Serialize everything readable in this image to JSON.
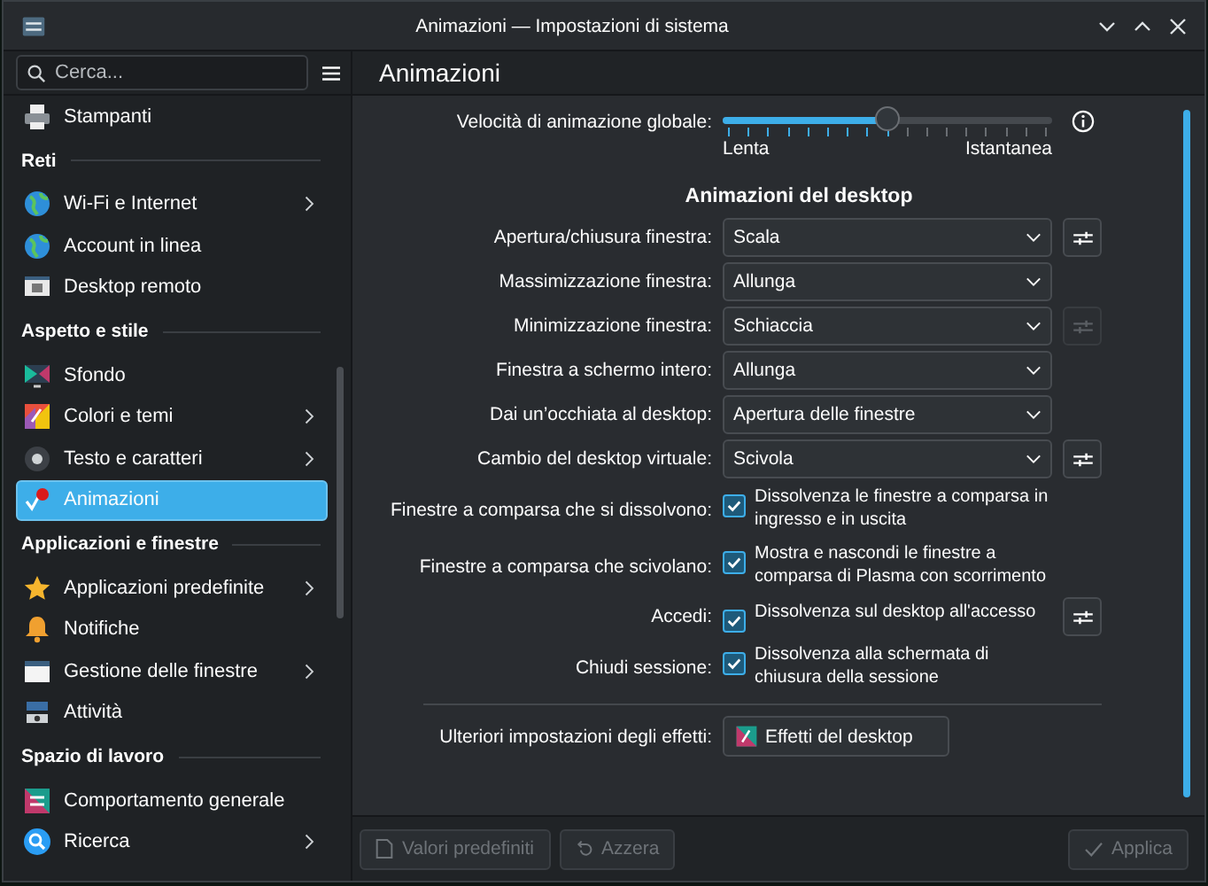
{
  "window": {
    "title": "Animazioni — Impostazioni di sistema"
  },
  "sidebar": {
    "search": {
      "placeholder": "Cerca..."
    },
    "entries": [
      {
        "kind": "item",
        "label": "Stampanti",
        "has_children": false,
        "selected": false
      },
      {
        "kind": "header",
        "label": "Reti"
      },
      {
        "kind": "item",
        "label": "Wi-Fi e Internet",
        "has_children": true,
        "selected": false
      },
      {
        "kind": "item",
        "label": "Account in linea",
        "has_children": false,
        "selected": false
      },
      {
        "kind": "item",
        "label": "Desktop remoto",
        "has_children": false,
        "selected": false
      },
      {
        "kind": "header",
        "label": "Aspetto e stile"
      },
      {
        "kind": "item",
        "label": "Sfondo",
        "has_children": false,
        "selected": false
      },
      {
        "kind": "item",
        "label": "Colori e temi",
        "has_children": true,
        "selected": false
      },
      {
        "kind": "item",
        "label": "Testo e caratteri",
        "has_children": true,
        "selected": false
      },
      {
        "kind": "item",
        "label": "Animazioni",
        "has_children": false,
        "selected": true
      },
      {
        "kind": "header",
        "label": "Applicazioni e finestre"
      },
      {
        "kind": "item",
        "label": "Applicazioni predefinite",
        "has_children": true,
        "selected": false
      },
      {
        "kind": "item",
        "label": "Notifiche",
        "has_children": false,
        "selected": false
      },
      {
        "kind": "item",
        "label": "Gestione delle finestre",
        "has_children": true,
        "selected": false
      },
      {
        "kind": "item",
        "label": "Attività",
        "has_children": false,
        "selected": false
      },
      {
        "kind": "header",
        "label": "Spazio di lavoro"
      },
      {
        "kind": "item",
        "label": "Comportamento generale",
        "has_children": false,
        "selected": false
      },
      {
        "kind": "item",
        "label": "Ricerca",
        "has_children": true,
        "selected": false
      }
    ]
  },
  "page_title": "Animazioni",
  "speed": {
    "label": "Velocità di animazione globale:",
    "level": 0.5,
    "min_label": "Lenta",
    "max_label": "Istantanea"
  },
  "section_title": "Animazioni del desktop",
  "rows": [
    {
      "kind": "dropdown",
      "label": "Apertura/chiusura finestra:",
      "value": "Scala",
      "settings_button": true,
      "settings_enabled": true
    },
    {
      "kind": "dropdown",
      "label": "Massimizzazione finestra:",
      "value": "Allunga",
      "settings_button": false
    },
    {
      "kind": "dropdown",
      "label": "Minimizzazione finestra:",
      "value": "Schiaccia",
      "settings_button": true,
      "settings_enabled": false
    },
    {
      "kind": "dropdown",
      "label": "Finestra a schermo intero:",
      "value": "Allunga",
      "settings_button": false
    },
    {
      "kind": "dropdown",
      "label": "Dai un’occhiata al desktop:",
      "value": "Apertura delle finestre",
      "settings_button": false
    },
    {
      "kind": "dropdown",
      "label": "Cambio del desktop virtuale:",
      "value": "Scivola",
      "settings_button": true,
      "settings_enabled": true
    },
    {
      "kind": "checkbox",
      "label": "Finestre a comparsa che si dissolvono:",
      "text": "Dissolvenza le finestre a comparsa in ingresso e in uscita",
      "checked": true,
      "settings_button": false
    },
    {
      "kind": "checkbox",
      "label": "Finestre a comparsa che scivolano:",
      "text": "Mostra e nascondi le finestre a comparsa di Plasma con scorrimento",
      "checked": true,
      "settings_button": false
    },
    {
      "kind": "checkbox",
      "label": "Accedi:",
      "text": "Dissolvenza sul desktop all'accesso",
      "checked": true,
      "settings_button": true,
      "settings_enabled": true
    },
    {
      "kind": "checkbox",
      "label": "Chiudi sessione:",
      "text": "Dissolvenza alla schermata di chiusura della sessione",
      "checked": true,
      "settings_button": false
    }
  ],
  "effects": {
    "label": "Ulteriori impostazioni degli effetti:",
    "button": "Effetti del desktop"
  },
  "footer": [
    {
      "kind": "defaults",
      "label": "Valori predefiniti",
      "disabled": true
    },
    {
      "kind": "reset",
      "label": "Azzera",
      "disabled": true
    },
    {
      "kind": "apply",
      "label": "Applica",
      "disabled": true
    }
  ]
}
